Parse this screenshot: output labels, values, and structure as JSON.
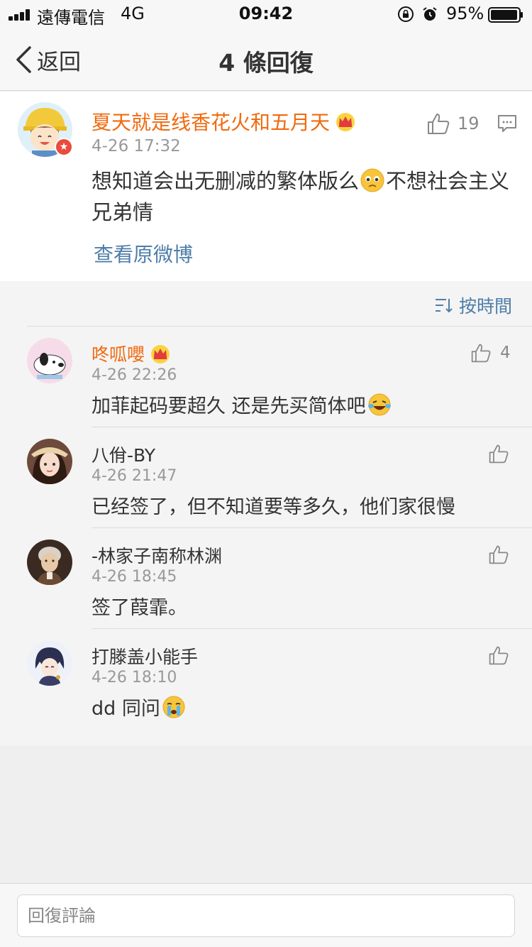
{
  "status_bar": {
    "carrier": "遠傳電信",
    "network": "4G",
    "time": "09:42",
    "battery": "95%"
  },
  "nav": {
    "back_label": "返回",
    "title": "4 條回復"
  },
  "main_post": {
    "author": "夏天就是线香花火和五月天",
    "time": "4-26 17:32",
    "text_part1": "想知道会出无删减的繁体版么",
    "text_part2": "不想社会主义兄弟情",
    "likes": "19",
    "view_original": "查看原微博"
  },
  "sort": {
    "label": "按時間"
  },
  "replies": [
    {
      "author": "咚呱嚶",
      "time": "4-26 22:26",
      "text": "加菲起码要超久 还是先买简体吧",
      "likes": "4",
      "vip": true
    },
    {
      "author": "八佾-BY",
      "time": "4-26 21:47",
      "text": "已经签了，但不知道要等多久，他们家很慢",
      "likes": ""
    },
    {
      "author": "-林家子南称林渊",
      "time": "4-26 18:45",
      "text": "签了葭霏。",
      "likes": ""
    },
    {
      "author": "打滕盖小能手",
      "time": "4-26 18:10",
      "text": "dd 同问",
      "likes": ""
    }
  ],
  "input": {
    "placeholder": "回復評論"
  },
  "colors": {
    "vip_name": "#f06a0f",
    "link_blue": "#4e7ea8",
    "verified_red": "#e84c3d"
  }
}
